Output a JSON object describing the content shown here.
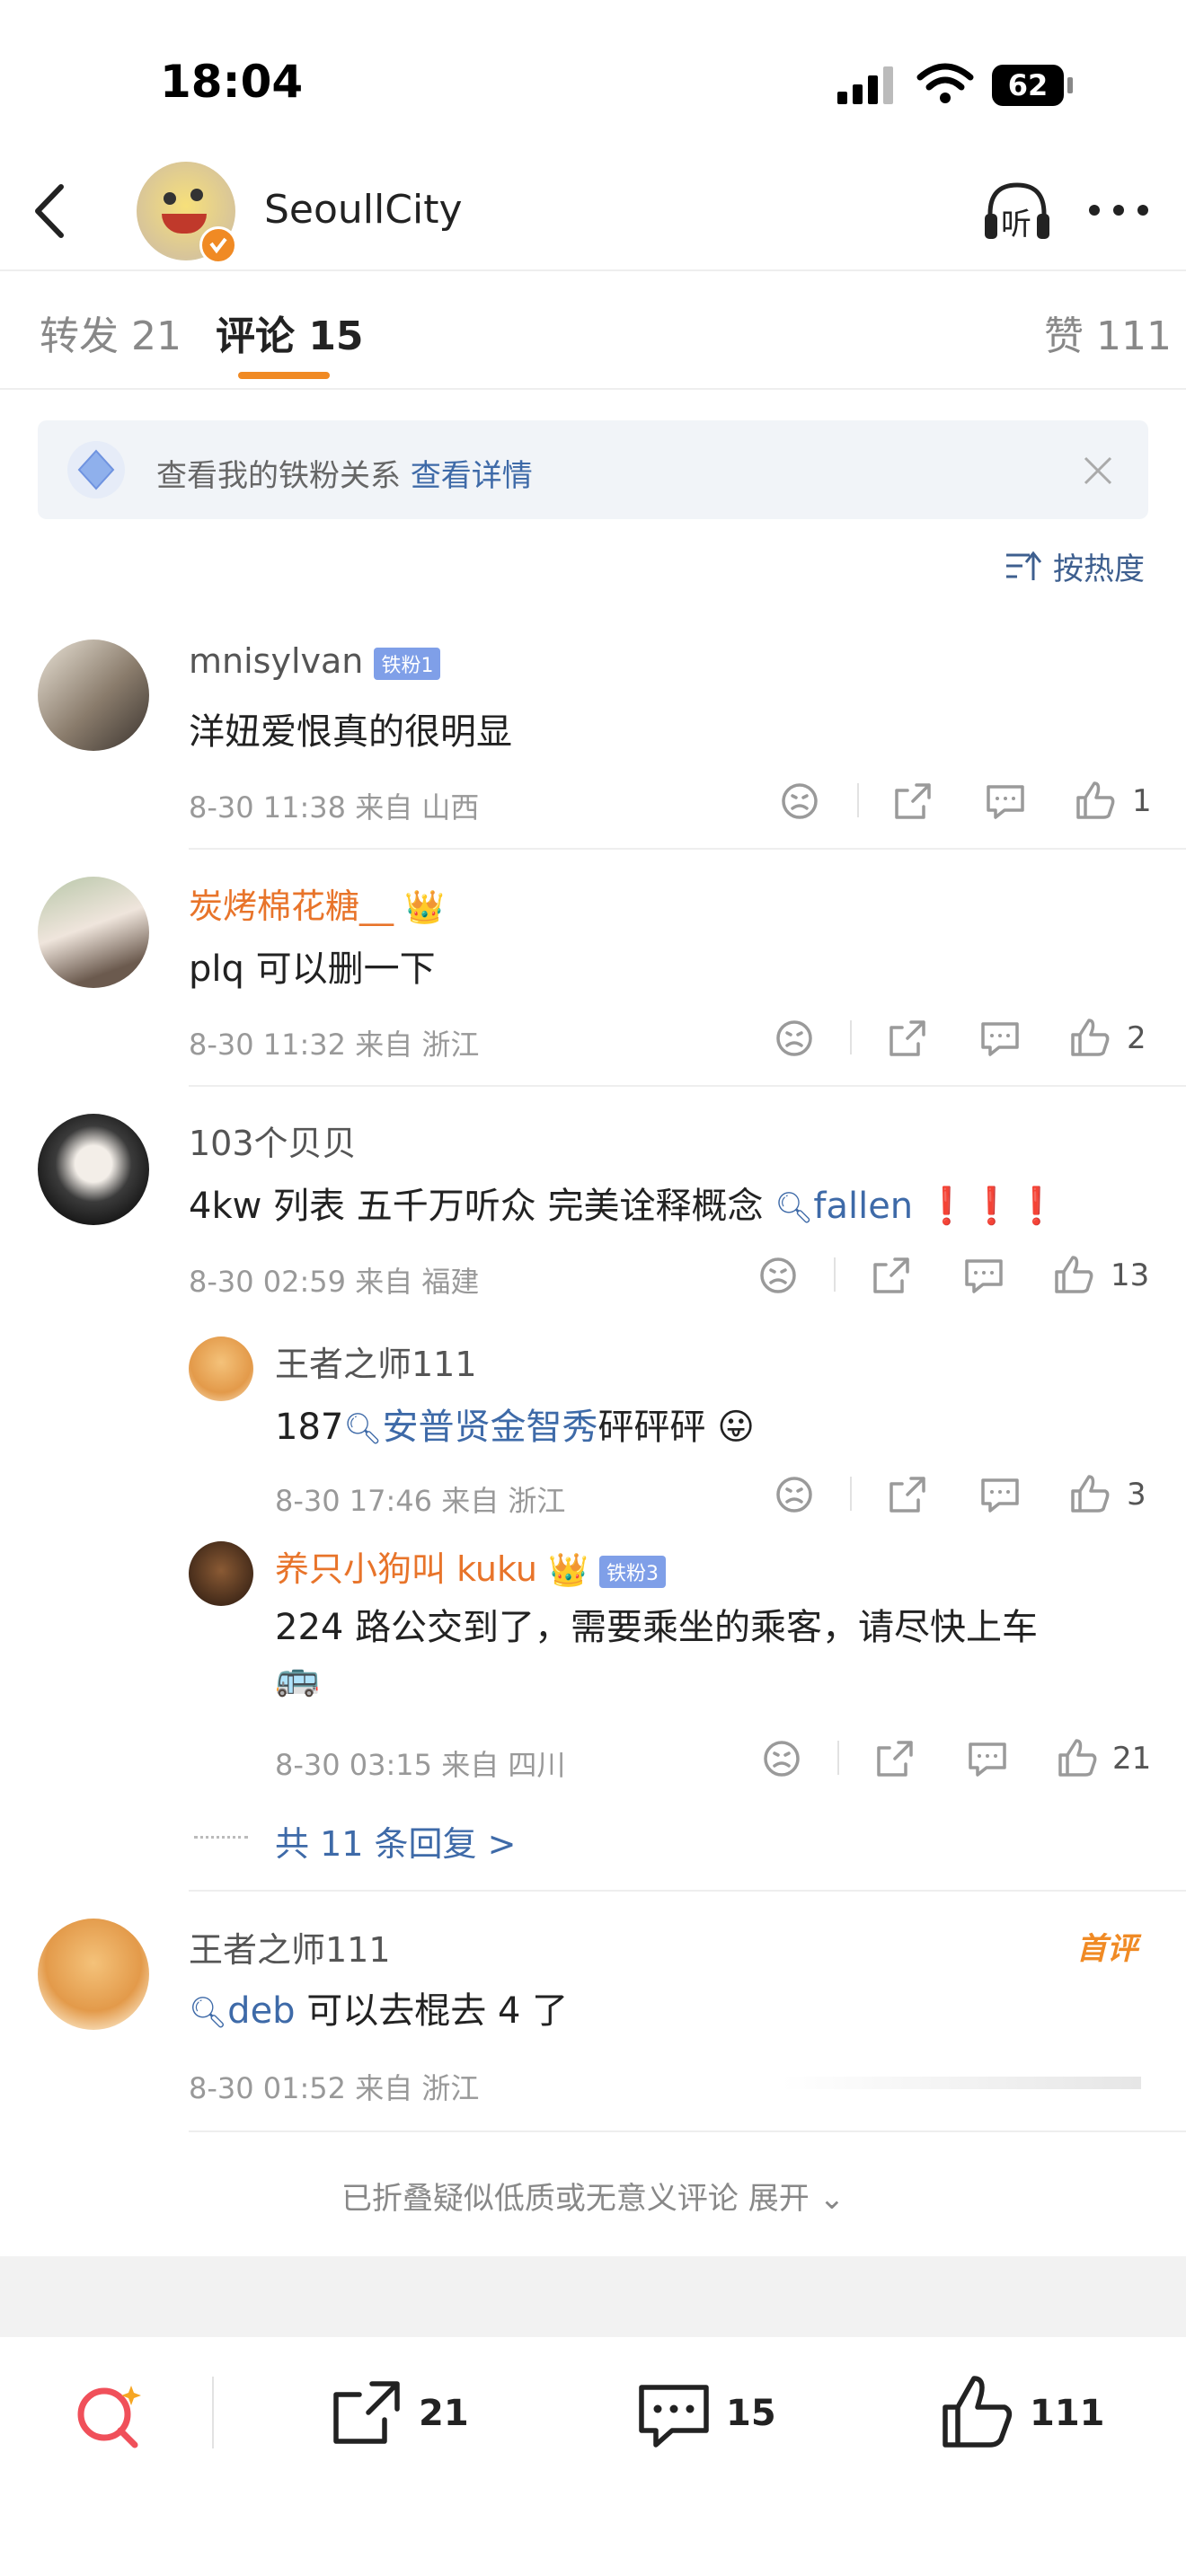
{
  "status_bar": {
    "time": "18:04",
    "battery": "62"
  },
  "header": {
    "username": "SeoullCity",
    "listen_label": "听"
  },
  "tabs": [
    {
      "label": "转发 21"
    },
    {
      "label": "评论 15"
    },
    {
      "label": "赞 111"
    }
  ],
  "banner": {
    "text": "查看我的铁粉关系",
    "link": "查看详情"
  },
  "sort": {
    "label": "按热度"
  },
  "comments": [
    {
      "user": "mnisylvan",
      "badge": "铁粉1",
      "text": "洋妞爱恨真的很明显",
      "meta": "8-30 11:38 来自 山西",
      "likes": "1"
    },
    {
      "user": "炭烤棉花糖__",
      "text": "plq 可以删一下",
      "meta": "8-30 11:32 来自 浙江",
      "likes": "2"
    },
    {
      "user": "103个贝贝",
      "text": "4kw 列表  五千万听众  完美诠释概念",
      "topic": "fallen",
      "exclaim": "❗️❗️❗️",
      "meta": "8-30 02:59 来自 福建",
      "likes": "13"
    },
    {
      "user": "王者之师111",
      "text": "可以去棍去 4 了",
      "topic": "deb",
      "tag": "首评",
      "meta": "8-30 01:52 来自 浙江"
    }
  ],
  "replies": [
    {
      "user": "王者之师111",
      "prefix": "187",
      "topic": "安普贤金智秀",
      "suffix": "砰砰砰",
      "meta": "8-30 17:46 来自 浙江",
      "likes": "3"
    },
    {
      "user": "养只小狗叫 kuku",
      "badge": "铁粉3",
      "text": "224 路公交到了，需要乘坐的乘客，请尽快上车",
      "emoji": "🚌",
      "meta": "8-30 03:15 来自 四川",
      "likes": "21"
    }
  ],
  "more_replies": "共 11 条回复 >",
  "folded": "已折叠疑似低质或无意义评论 展开",
  "bottom_bar": {
    "reposts": "21",
    "comments": "15",
    "likes": "111"
  },
  "colors": {
    "accent_orange": "#f08a24",
    "link_blue": "#3e6aa8",
    "badge_blue": "#7f9fe8"
  }
}
